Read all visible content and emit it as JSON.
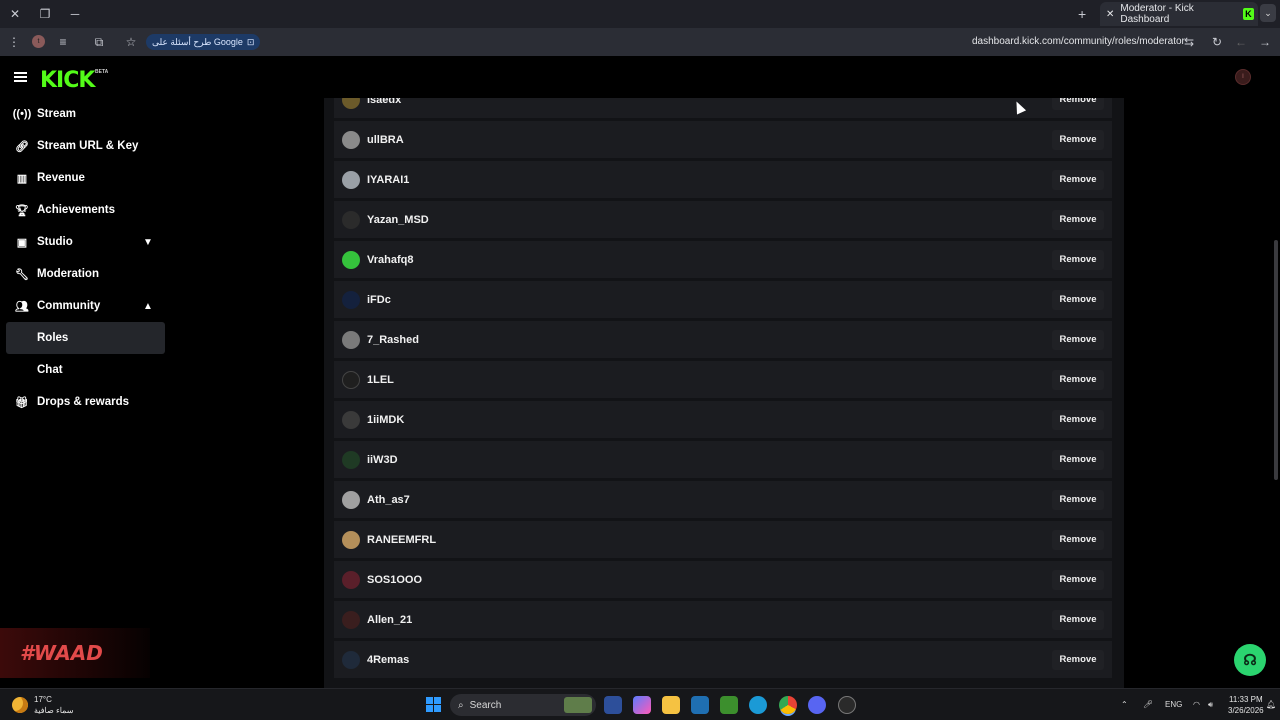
{
  "browser": {
    "tab_title": "Moderator - Kick Dashboard",
    "tab_favicon": "K",
    "url": "dashboard.kick.com/community/roles/moderator",
    "google_pill": "طرح أسئلة على Google",
    "profile_initial": "t"
  },
  "header": {
    "logo": "KICK",
    "beta": "BETA",
    "user_initial": "I"
  },
  "sidebar": {
    "items": [
      {
        "label": "Stream",
        "icon": "broadcast-icon"
      },
      {
        "label": "Stream URL & Key",
        "icon": "link-icon"
      },
      {
        "label": "Revenue",
        "icon": "chart-icon"
      },
      {
        "label": "Achievements",
        "icon": "trophy-icon"
      },
      {
        "label": "Studio",
        "icon": "studio-icon"
      },
      {
        "label": "Moderation",
        "icon": "wrench-icon"
      },
      {
        "label": "Community",
        "icon": "community-icon"
      },
      {
        "label": "Roles"
      },
      {
        "label": "Chat"
      },
      {
        "label": "Drops & rewards",
        "icon": "gift-icon"
      }
    ]
  },
  "moderators": {
    "remove_label": "Remove",
    "rows": [
      {
        "name": "isaedx",
        "color": "#6b5a2a"
      },
      {
        "name": "ullBRA",
        "color": "#8a8a8a"
      },
      {
        "name": "IYARAI1",
        "color": "#9aa0a6"
      },
      {
        "name": "Yazan_MSD",
        "color": "#2b2b2b"
      },
      {
        "name": "Vrahafq8",
        "color": "#35c23c"
      },
      {
        "name": "iFDc",
        "color": "#14213d"
      },
      {
        "name": "7_Rashed",
        "color": "#7a7a7a"
      },
      {
        "name": "1LEL",
        "color": "#1f1f1f"
      },
      {
        "name": "1iiMDK",
        "color": "#3a3a3a"
      },
      {
        "name": "iiW3D",
        "color": "#1f3a24"
      },
      {
        "name": "Ath_as7",
        "color": "#a0a0a0"
      },
      {
        "name": "RANEEMFRL",
        "color": "#b48f5a"
      },
      {
        "name": "SOS1OOO",
        "color": "#5a1f2a"
      },
      {
        "name": "Allen_21",
        "color": "#3a1e1e"
      },
      {
        "name": "4Remas",
        "color": "#1f2a3a"
      }
    ]
  },
  "watermark": "#WAAD",
  "taskbar": {
    "temp": "17°C",
    "weather_desc": "سماء صافية",
    "search_placeholder": "Search",
    "lang": "ENG",
    "time": "11:33 PM",
    "date": "3/26/2026"
  }
}
